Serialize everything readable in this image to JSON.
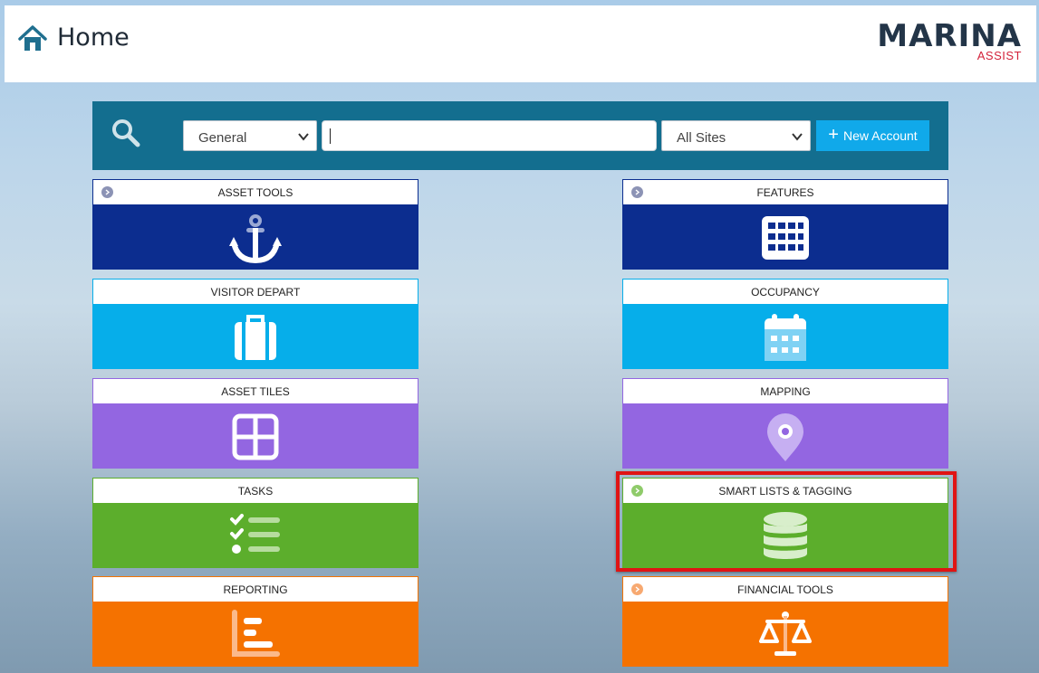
{
  "header": {
    "title": "Home"
  },
  "logo": {
    "main": "MARINA",
    "sub": "ASSIST"
  },
  "search": {
    "category_value": "General",
    "query_value": "",
    "sites_value": "All Sites",
    "new_account_label": "New Account"
  },
  "tiles": [
    {
      "label": "ASSET TOOLS",
      "icon": "anchor-icon",
      "color": "#0c2d8f",
      "has_expand": true,
      "expand_color": "#8c93b5"
    },
    {
      "label": "FEATURES",
      "icon": "grid-icon",
      "color": "#0c2d8f",
      "has_expand": true,
      "expand_color": "#8c93b5"
    },
    {
      "label": "VISITOR DEPART",
      "icon": "suitcase-icon",
      "color": "#06aeea"
    },
    {
      "label": "OCCUPANCY",
      "icon": "calendar-icon",
      "color": "#06aeea"
    },
    {
      "label": "ASSET TILES",
      "icon": "tiles-icon",
      "color": "#9366e1"
    },
    {
      "label": "MAPPING",
      "icon": "map-pin-icon",
      "color": "#9366e1"
    },
    {
      "label": "TASKS",
      "icon": "checklist-icon",
      "color": "#5cae2c"
    },
    {
      "label": "SMART LISTS & TAGGING",
      "icon": "database-icon",
      "color": "#5cae2c",
      "has_expand": true,
      "expand_color": "#8fcb6a",
      "highlighted": true
    },
    {
      "label": "REPORTING",
      "icon": "report-icon",
      "color": "#f57200"
    },
    {
      "label": "FINANCIAL TOOLS",
      "icon": "scales-icon",
      "color": "#f57200",
      "has_expand": true,
      "expand_color": "#f7a971"
    }
  ]
}
